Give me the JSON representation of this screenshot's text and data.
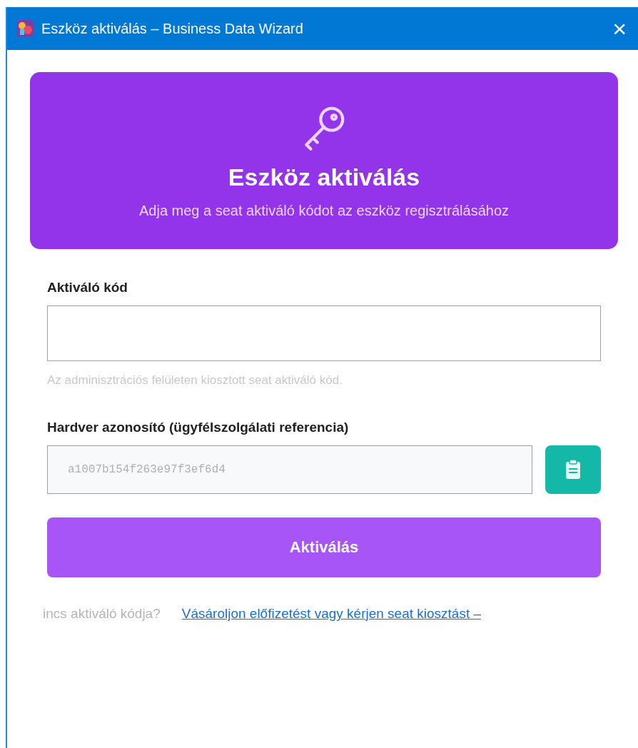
{
  "window": {
    "title": "Eszköz aktiválás – Business Data Wizard",
    "close": "×"
  },
  "header": {
    "title": "Eszköz aktiválás",
    "subtitle": "Adja meg a seat aktiváló kódot az eszköz regisztrálásához"
  },
  "code_field": {
    "label": "Aktiváló kód",
    "help": "Az adminisztrációs felületen kiosztott seat aktiváló kód."
  },
  "hardware_field": {
    "label": "Hardver azonosító (ügyfélszolgálati referencia)",
    "value": "a1007b154f263e97f3ef6d4"
  },
  "activate_button": "Aktiválás",
  "footer": {
    "question": "incs aktiváló kódja?",
    "link": "Vásároljon előfizetést vagy kérjen seat kiosztást –"
  }
}
